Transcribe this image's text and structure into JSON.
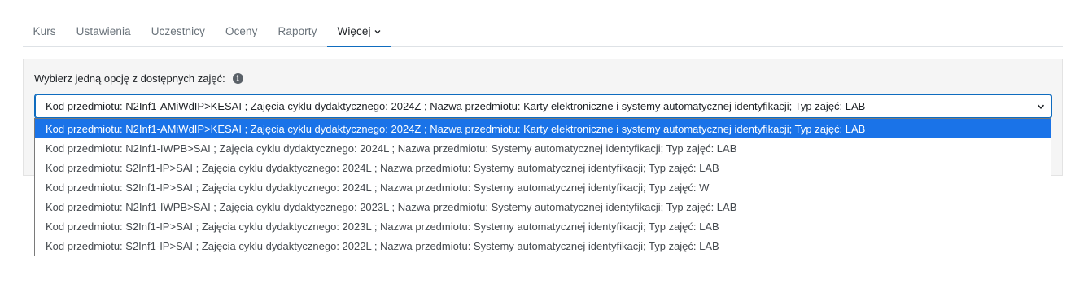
{
  "tabs": [
    {
      "label": "Kurs"
    },
    {
      "label": "Ustawienia"
    },
    {
      "label": "Uczestnicy"
    },
    {
      "label": "Oceny"
    },
    {
      "label": "Raporty"
    },
    {
      "label": "Więcej"
    }
  ],
  "form": {
    "prompt": "Wybierz jedną opcję z dostępnych zajęć:",
    "info_icon": "info-circle-icon",
    "selected_value": "Kod przedmiotu: N2Inf1-AMiWdIP>KESAI ; Zajęcia cyklu dydaktycznego: 2024Z ; Nazwa przedmiotu: Karty elektroniczne i systemy automatycznej identyfikacji; Typ zajęć: LAB"
  },
  "options": [
    "Kod przedmiotu: N2Inf1-AMiWdIP>KESAI ; Zajęcia cyklu dydaktycznego: 2024Z ; Nazwa przedmiotu: Karty elektroniczne i systemy automatycznej identyfikacji; Typ zajęć: LAB",
    "Kod przedmiotu: N2Inf1-IWPB>SAI ; Zajęcia cyklu dydaktycznego: 2024L ; Nazwa przedmiotu: Systemy automatycznej identyfikacji; Typ zajęć: LAB",
    "Kod przedmiotu: S2Inf1-IP>SAI ; Zajęcia cyklu dydaktycznego: 2024L ; Nazwa przedmiotu: Systemy automatycznej identyfikacji; Typ zajęć: LAB",
    "Kod przedmiotu: S2Inf1-IP>SAI ; Zajęcia cyklu dydaktycznego: 2024L ; Nazwa przedmiotu: Systemy automatycznej identyfikacji; Typ zajęć: W",
    "Kod przedmiotu: N2Inf1-IWPB>SAI ; Zajęcia cyklu dydaktycznego: 2023L ; Nazwa przedmiotu: Systemy automatycznej identyfikacji; Typ zajęć: LAB",
    "Kod przedmiotu: S2Inf1-IP>SAI ; Zajęcia cyklu dydaktycznego: 2023L ; Nazwa przedmiotu: Systemy automatycznej identyfikacji; Typ zajęć: LAB",
    "Kod przedmiotu: S2Inf1-IP>SAI ; Zajęcia cyklu dydaktycznego: 2022L ; Nazwa przedmiotu: Systemy automatycznej identyfikacji; Typ zajęć: LAB"
  ],
  "colors": {
    "accent": "#0f6cbf",
    "highlight": "#1a73e8"
  }
}
